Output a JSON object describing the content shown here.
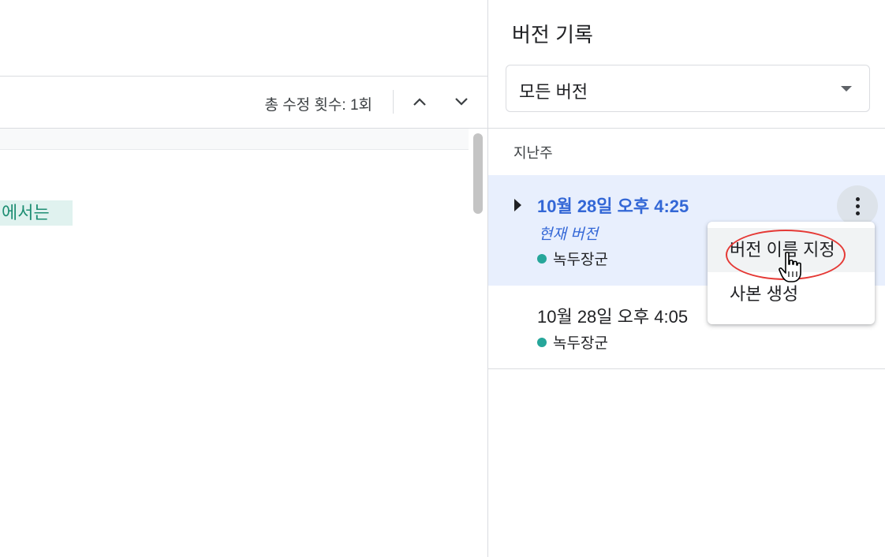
{
  "toolbar": {
    "edit_count": "총 수정 횟수: 1회"
  },
  "document": {
    "highlight_text": "에서는"
  },
  "panel": {
    "title": "버전 기록",
    "filter": {
      "value": "모든 버전"
    },
    "section_label": "지난주",
    "versions": [
      {
        "date": "10월 28일 오후 4:25",
        "status": "현재 버전",
        "author": "녹두장군"
      },
      {
        "date": "10월 28일 오후 4:05",
        "author": "녹두장군"
      }
    ]
  },
  "menu": {
    "items": [
      {
        "label": "버전 이름 지정"
      },
      {
        "label": "사본 생성"
      }
    ]
  },
  "colors": {
    "accent": "#3367d6",
    "selected_bg": "#e8effd",
    "author_dot": "#26a69a",
    "annotation": "#e53935"
  },
  "icons": {
    "nav_up": "chevron-up-icon",
    "nav_down": "chevron-down-icon",
    "more": "more-vertical-icon",
    "expand": "triangle-right-icon",
    "cursor": "hand-pointer-icon"
  }
}
